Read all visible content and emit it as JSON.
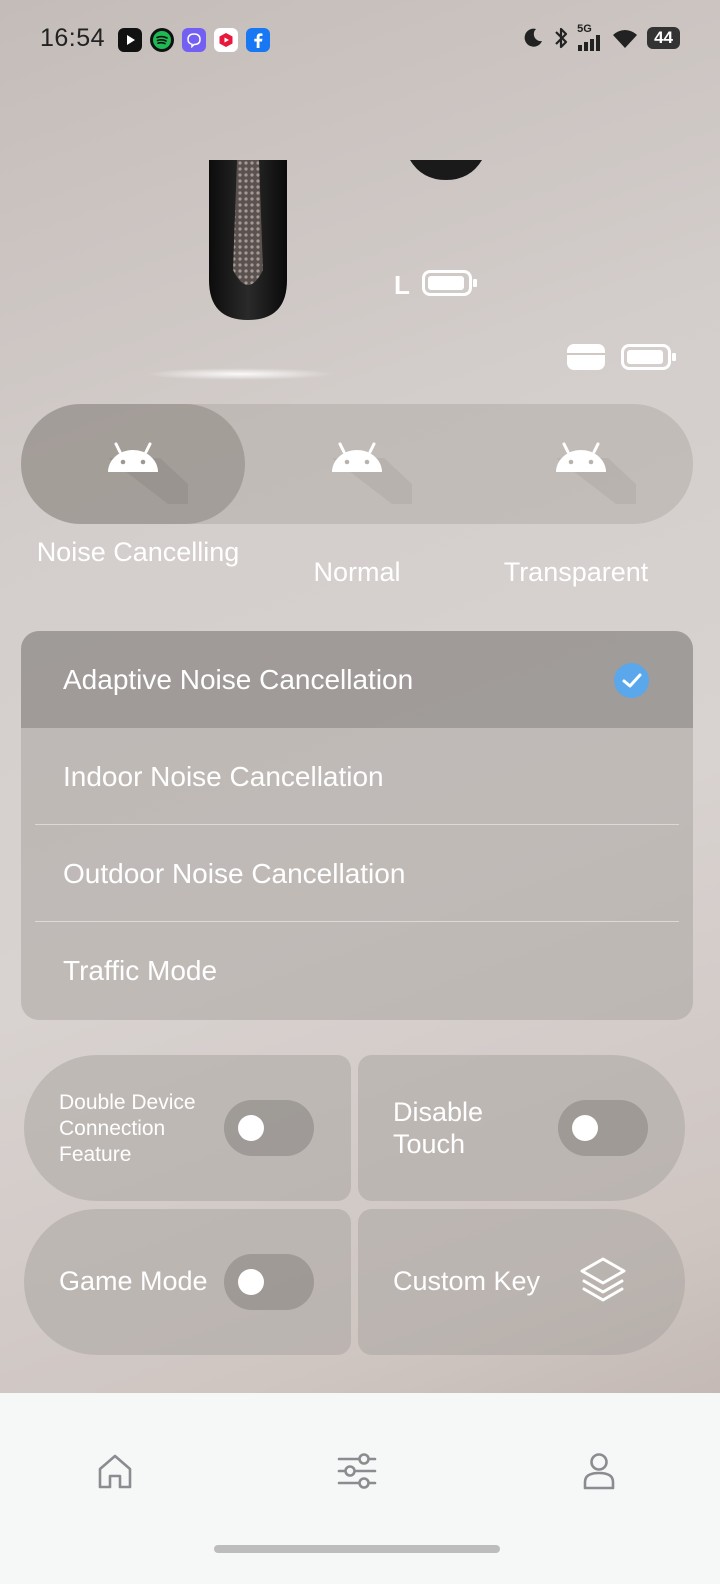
{
  "status_bar": {
    "time": "16:54",
    "network": "5G",
    "battery_level": "44",
    "app_icons": [
      "youtube-icon",
      "spotify-icon",
      "viber-icon",
      "video-app-icon",
      "facebook-icon"
    ],
    "system_icons": [
      "moon-icon",
      "bluetooth-icon",
      "signal-icon",
      "wifi-icon",
      "battery-icon"
    ]
  },
  "hero": {
    "left_label": "L",
    "left_battery_level": 0.95,
    "case_battery_level": 0.95
  },
  "modes": {
    "active": "Noise Cancelling",
    "items": [
      {
        "label": "Noise Cancelling",
        "icon": "android-icon"
      },
      {
        "label": "Normal",
        "icon": "android-icon"
      },
      {
        "label": "Transparent",
        "icon": "android-icon"
      }
    ]
  },
  "noise_cancellation": {
    "selected": "Adaptive Noise Cancellation",
    "options": [
      "Adaptive Noise Cancellation",
      "Indoor Noise Cancellation",
      "Outdoor Noise Cancellation",
      "Traffic Mode"
    ]
  },
  "features": {
    "double_device": {
      "label": "Double Device Connection Feature",
      "enabled": false
    },
    "disable_touch": {
      "label": "Disable Touch",
      "enabled": false
    },
    "game_mode": {
      "label": "Game Mode",
      "enabled": false
    },
    "custom_key": {
      "label": "Custom Key",
      "icon": "layers-icon"
    }
  },
  "bottom_nav": {
    "items": [
      {
        "name": "home",
        "icon": "home-icon"
      },
      {
        "name": "settings",
        "icon": "sliders-icon"
      },
      {
        "name": "profile",
        "icon": "user-icon"
      }
    ]
  },
  "colors": {
    "accent": "#5aa7ec",
    "text_on_glass": "#ffffff",
    "nav_background": "#f6f7f7"
  }
}
